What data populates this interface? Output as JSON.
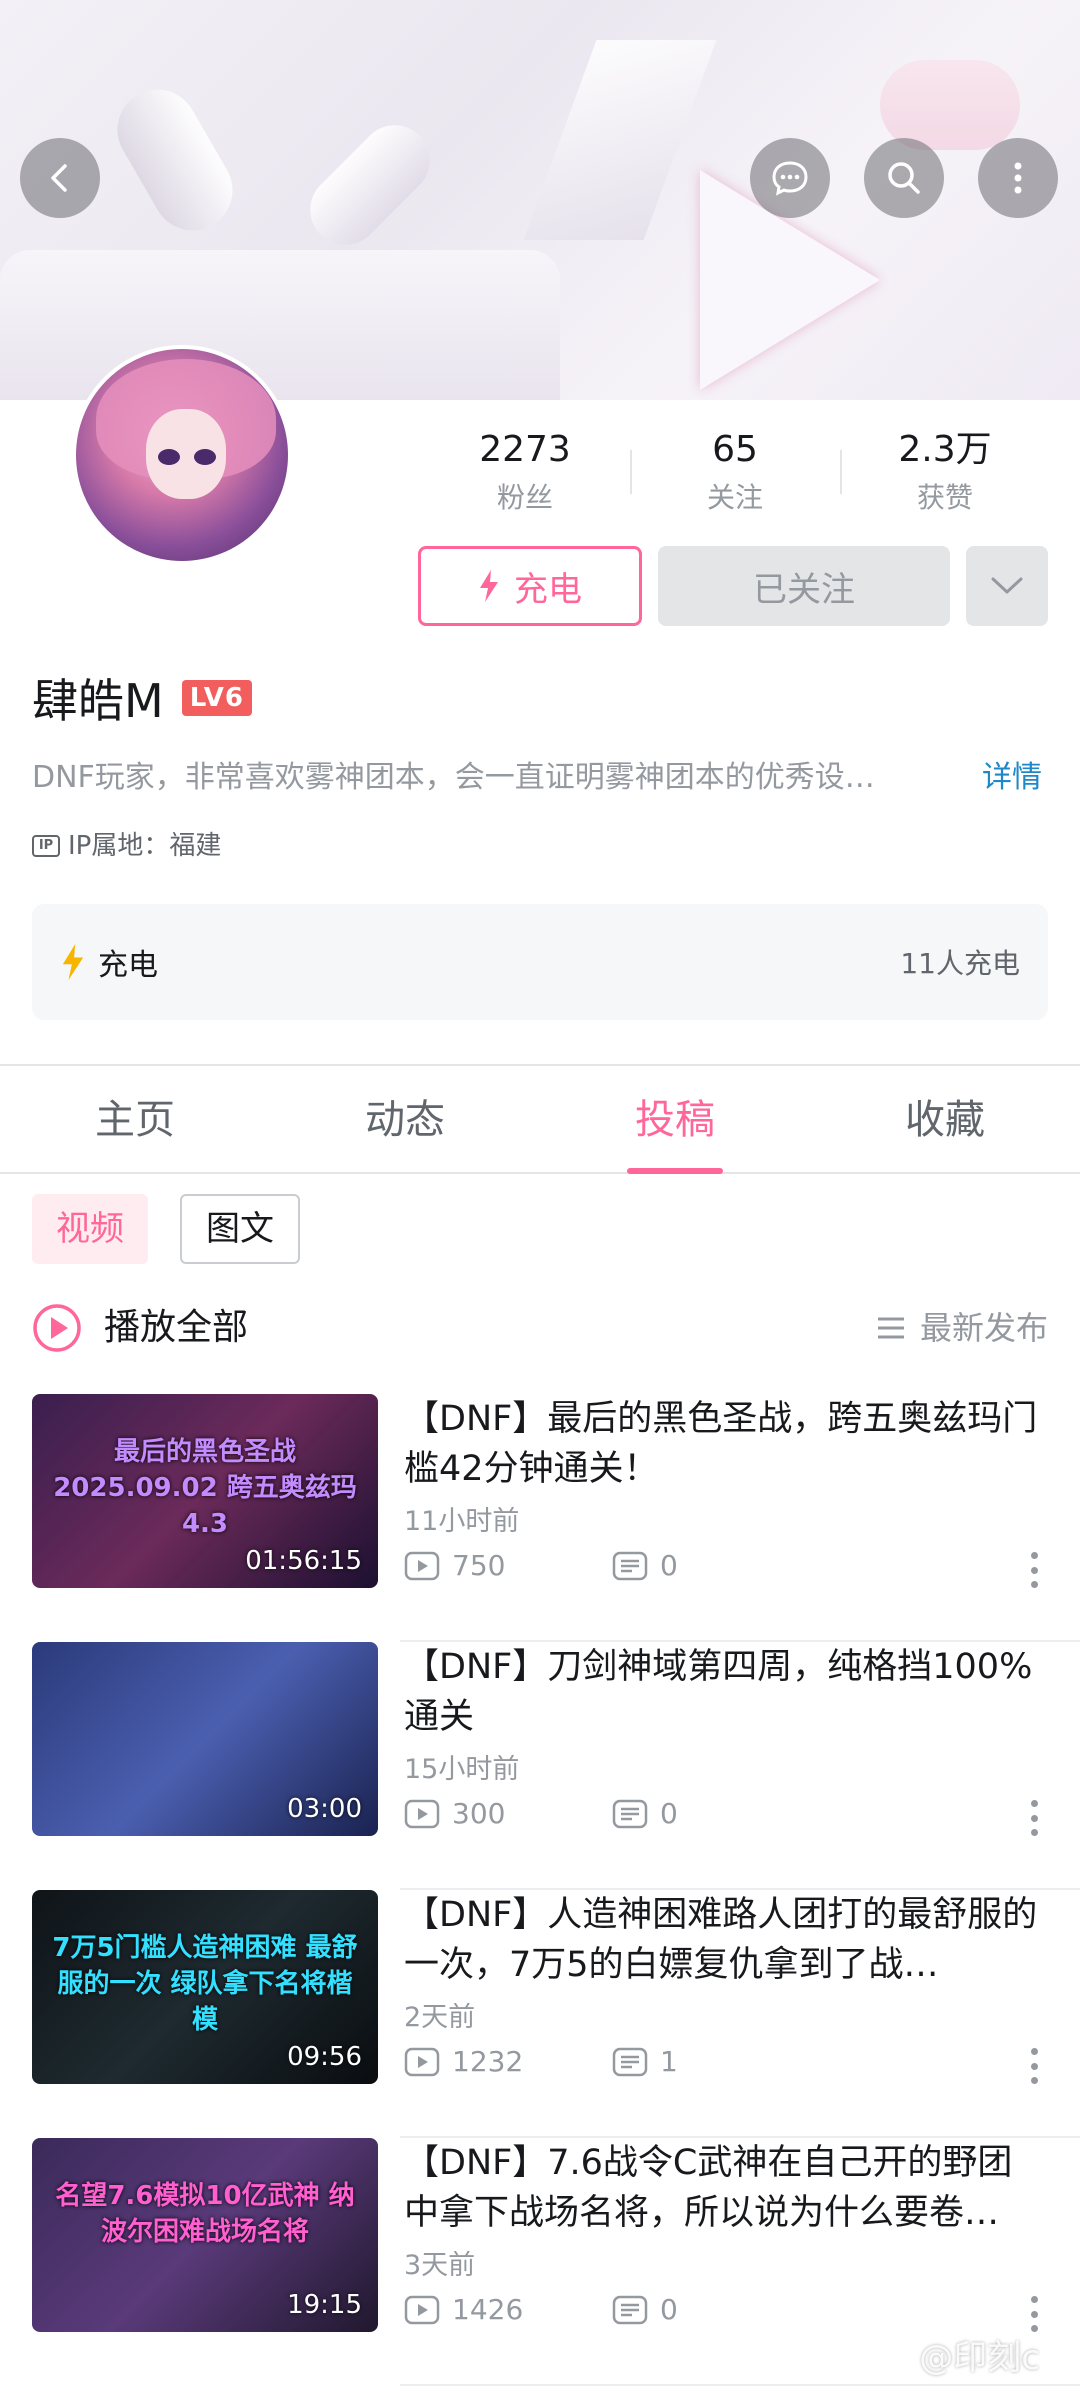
{
  "header": {
    "back_icon": "chevron-left-icon",
    "message_icon": "chat-bubble-icon",
    "search_icon": "search-icon",
    "more_icon": "vertical-dots-icon"
  },
  "profile": {
    "username": "肆皓M",
    "level_badge": "LV6",
    "bio": "DNF玩家，非常喜欢雾神团本，会一直证明雾神团本的优秀设…",
    "detail_link": "详情",
    "ip_label": "IP属地：福建",
    "stats": [
      {
        "value": "2273",
        "label": "粉丝"
      },
      {
        "value": "65",
        "label": "关注"
      },
      {
        "value": "2.3万",
        "label": "获赞"
      }
    ],
    "charge_button": "充电",
    "followed_button": "已关注"
  },
  "charge_card": {
    "title": "充电",
    "count": "11人充电"
  },
  "tabs": [
    {
      "label": "主页",
      "active": false
    },
    {
      "label": "动态",
      "active": false
    },
    {
      "label": "投稿",
      "active": true
    },
    {
      "label": "收藏",
      "active": false
    }
  ],
  "subtabs": [
    {
      "label": "视频",
      "active": true
    },
    {
      "label": "图文",
      "active": false
    }
  ],
  "list_header": {
    "play_all": "播放全部",
    "sort": "最新发布"
  },
  "videos": [
    {
      "title": "【DNF】最后的黑色圣战，跨五奥兹玛门槛42分钟通关！",
      "time": "11小时前",
      "views": "750",
      "comments": "0",
      "duration": "01:56:15",
      "thumb_text": "最后的黑色圣战 2025.09.02 跨五奥兹玛4.3",
      "thumb_colors": [
        "#3a1f4f",
        "#6b2a5a",
        "#1c1030"
      ],
      "thumb_text_color": "#c48bff"
    },
    {
      "title": "【DNF】刀剑神域第四周，纯格挡100%通关",
      "time": "15小时前",
      "views": "300",
      "comments": "0",
      "duration": "03:00",
      "thumb_text": "",
      "thumb_colors": [
        "#2b3a7a",
        "#4b5fb0",
        "#1a2250"
      ],
      "thumb_text_color": "#ffffff"
    },
    {
      "title": "【DNF】人造神困难路人团打的最舒服的一次，7万5的白嫖复仇拿到了战…",
      "time": "2天前",
      "views": "1232",
      "comments": "1",
      "duration": "09:56",
      "thumb_text": "7万5门槛人造神困难 最舒服的一次 绿队拿下名将楷模",
      "thumb_colors": [
        "#0f1418",
        "#1e2a30",
        "#0a0d10"
      ],
      "thumb_text_color": "#33e0ff"
    },
    {
      "title": "【DNF】7.6战令C武神在自己开的野团中拿下战场名将，所以说为什么要卷…",
      "time": "3天前",
      "views": "1426",
      "comments": "0",
      "duration": "19:15",
      "thumb_text": "名望7.6模拟10亿武神 纳波尔困难战场名将",
      "thumb_colors": [
        "#3b2a5a",
        "#5a3a7a",
        "#20182e"
      ],
      "thumb_text_color": "#ff5fd0"
    }
  ],
  "watermark": "@印刻c",
  "colors": {
    "accent": "#ff6699",
    "link": "#1e88c8",
    "level_badge": "#f25d5d",
    "charge_icon": "#f7b500"
  }
}
